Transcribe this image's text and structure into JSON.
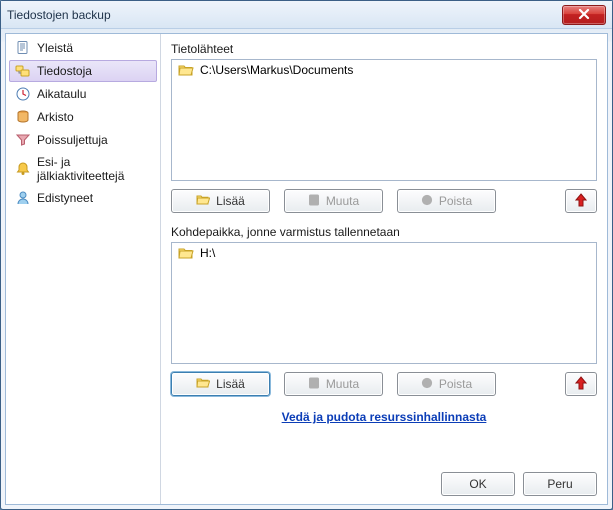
{
  "window": {
    "title": "Tiedostojen backup"
  },
  "sidebar": {
    "items": [
      {
        "label": "Yleistä"
      },
      {
        "label": "Tiedostoja"
      },
      {
        "label": "Aikataulu"
      },
      {
        "label": "Arkisto"
      },
      {
        "label": "Poissuljettuja"
      },
      {
        "label": "Esi- ja jälkiaktiviteettejä"
      },
      {
        "label": "Edistyneet"
      }
    ],
    "selected": 1
  },
  "main": {
    "sources": {
      "label": "Tietolähteet",
      "items": [
        {
          "path": "C:\\Users\\Markus\\Documents"
        }
      ],
      "btn_add": "Lisää",
      "btn_edit": "Muuta",
      "btn_remove": "Poista"
    },
    "dest": {
      "label": "Kohdepaikka, jonne varmistus tallennetaan",
      "items": [
        {
          "path": "H:\\"
        }
      ],
      "btn_add": "Lisää",
      "btn_edit": "Muuta",
      "btn_remove": "Poista"
    },
    "drag_link": "Vedä ja pudota resurssinhallinnasta"
  },
  "dialog": {
    "ok": "OK",
    "cancel": "Peru"
  }
}
